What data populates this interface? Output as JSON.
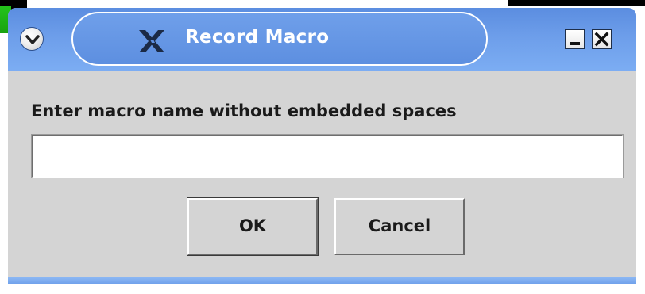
{
  "background": {
    "visible_text": "",
    "accent_green": "#1fb316"
  },
  "window": {
    "title": "Record Macro",
    "title_icon": "x-logo-icon",
    "menu_icon": "chevron-down-icon",
    "controls": {
      "minimize_icon": "minimize-icon",
      "close_icon": "close-icon"
    },
    "titlebar_color": "#6a9ce8"
  },
  "dialog": {
    "prompt": "Enter macro name without embedded spaces",
    "input_value": "",
    "ok_label": "OK",
    "cancel_label": "Cancel"
  }
}
